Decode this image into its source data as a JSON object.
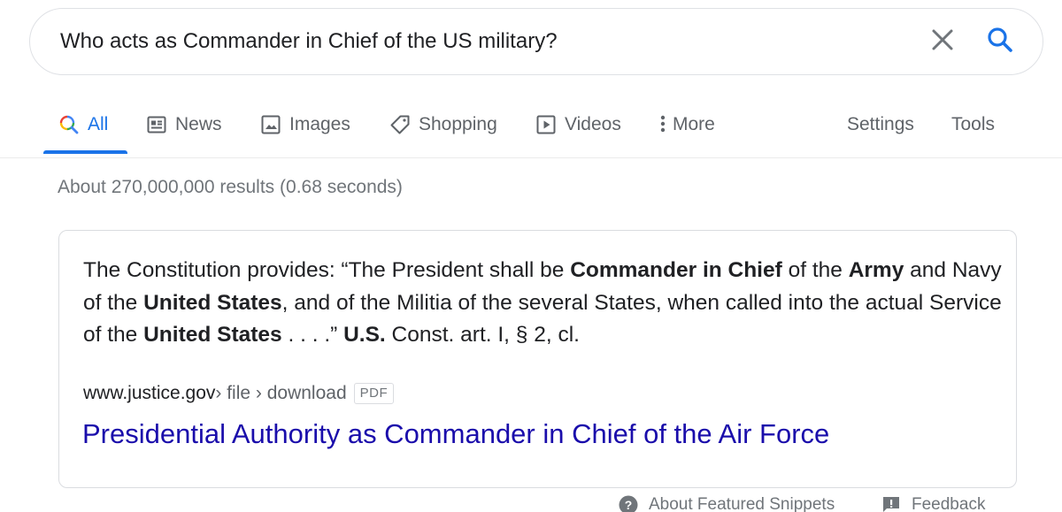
{
  "search": {
    "query": "Who acts as Commander in Chief of the US military?",
    "clear_icon": "close-icon",
    "search_icon": "search-icon"
  },
  "tabs": [
    {
      "label": "All",
      "icon": "search-icon",
      "active": true
    },
    {
      "label": "News",
      "icon": "news-icon"
    },
    {
      "label": "Images",
      "icon": "image-icon"
    },
    {
      "label": "Shopping",
      "icon": "tag-icon"
    },
    {
      "label": "Videos",
      "icon": "play-icon"
    },
    {
      "label": "More",
      "icon": "more-vert-icon"
    },
    {
      "label": "Settings"
    },
    {
      "label": "Tools"
    }
  ],
  "results_stats": "About 270,000,000 results (0.68 seconds)",
  "snippet": {
    "segments": [
      {
        "text": "The Constitution provides: “The President shall be "
      },
      {
        "text": "Commander in Chief",
        "bold": true
      },
      {
        "text": " of the "
      },
      {
        "text": "Army",
        "bold": true
      },
      {
        "text": " and Navy of the "
      },
      {
        "text": "United States",
        "bold": true
      },
      {
        "text": ", and of the Militia of the several States, when called into the actual Service of the "
      },
      {
        "text": "United States",
        "bold": true
      },
      {
        "text": " . . . .” "
      },
      {
        "text": "U.S.",
        "bold": true
      },
      {
        "text": " Const. art. I, § 2, cl."
      }
    ],
    "source_domain": "www.justice.gov",
    "source_path": " › file › download",
    "badge": "PDF",
    "link_title": "Presidential Authority as Commander in Chief of the Air Force"
  },
  "footer": {
    "about": "About Featured Snippets",
    "feedback": "Feedback"
  },
  "colors": {
    "accent": "#1a73e8",
    "link": "#1a0dab",
    "muted": "#70757a"
  }
}
